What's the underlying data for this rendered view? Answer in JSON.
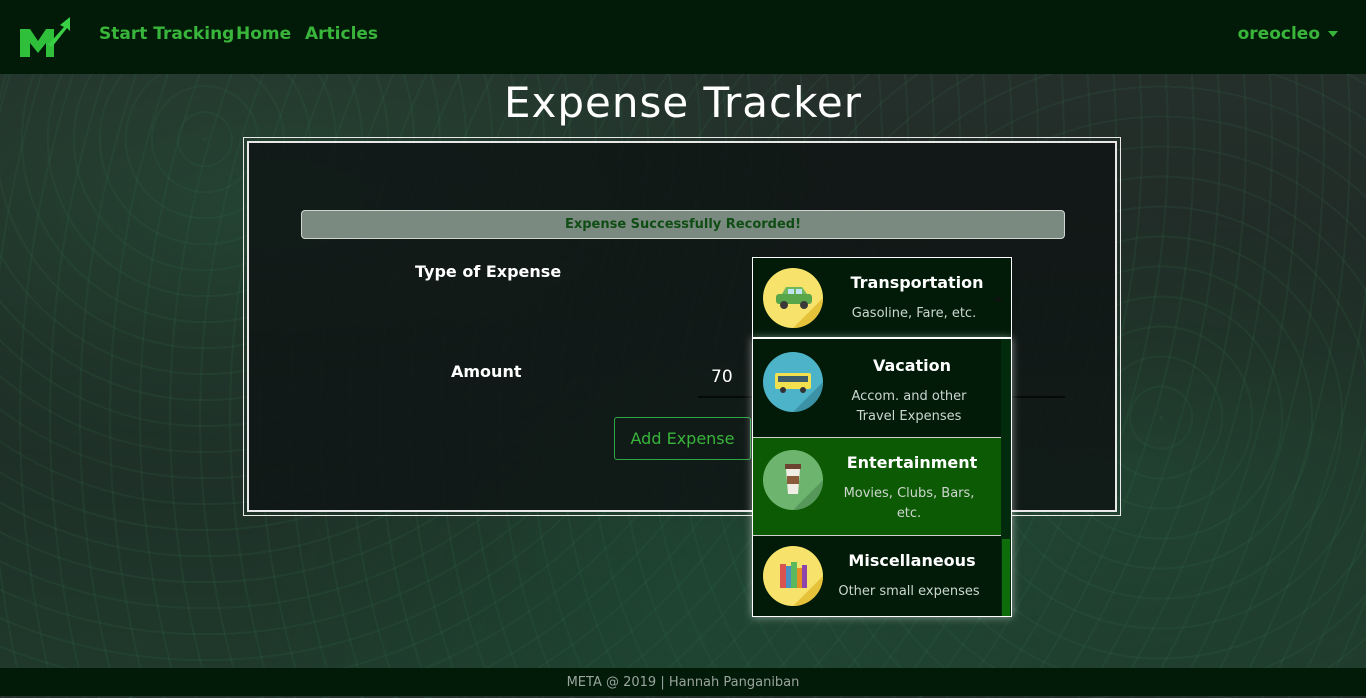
{
  "navbar": {
    "links": [
      "Start Tracking",
      "Home",
      "Articles"
    ],
    "user": "oreocleo",
    "accent_color": "#38b53a",
    "background_color": "#011b08"
  },
  "page_title": "Expense Tracker",
  "alert": {
    "message": "Expense Successfully Recorded!"
  },
  "form": {
    "type_label": "Type of Expense",
    "amount_label": "Amount",
    "amount_value": "70",
    "submit_label": "Add Expense"
  },
  "expense_select": {
    "selected": {
      "title": "Transportation",
      "description": "Gasoline, Fare, etc.",
      "icon": "car-icon"
    },
    "options": [
      {
        "title": "Vacation",
        "description": "Accom. and other Travel Expenses",
        "icon": "bus-icon"
      },
      {
        "title": "Entertainment",
        "description": "Movies, Clubs, Bars, etc.",
        "icon": "coffee-cup-icon",
        "highlighted": true
      },
      {
        "title": "Miscellaneous",
        "description": "Other small expenses",
        "icon": "books-icon"
      }
    ]
  },
  "footer": {
    "text": "META @ 2019 | Hannah Panganiban"
  }
}
